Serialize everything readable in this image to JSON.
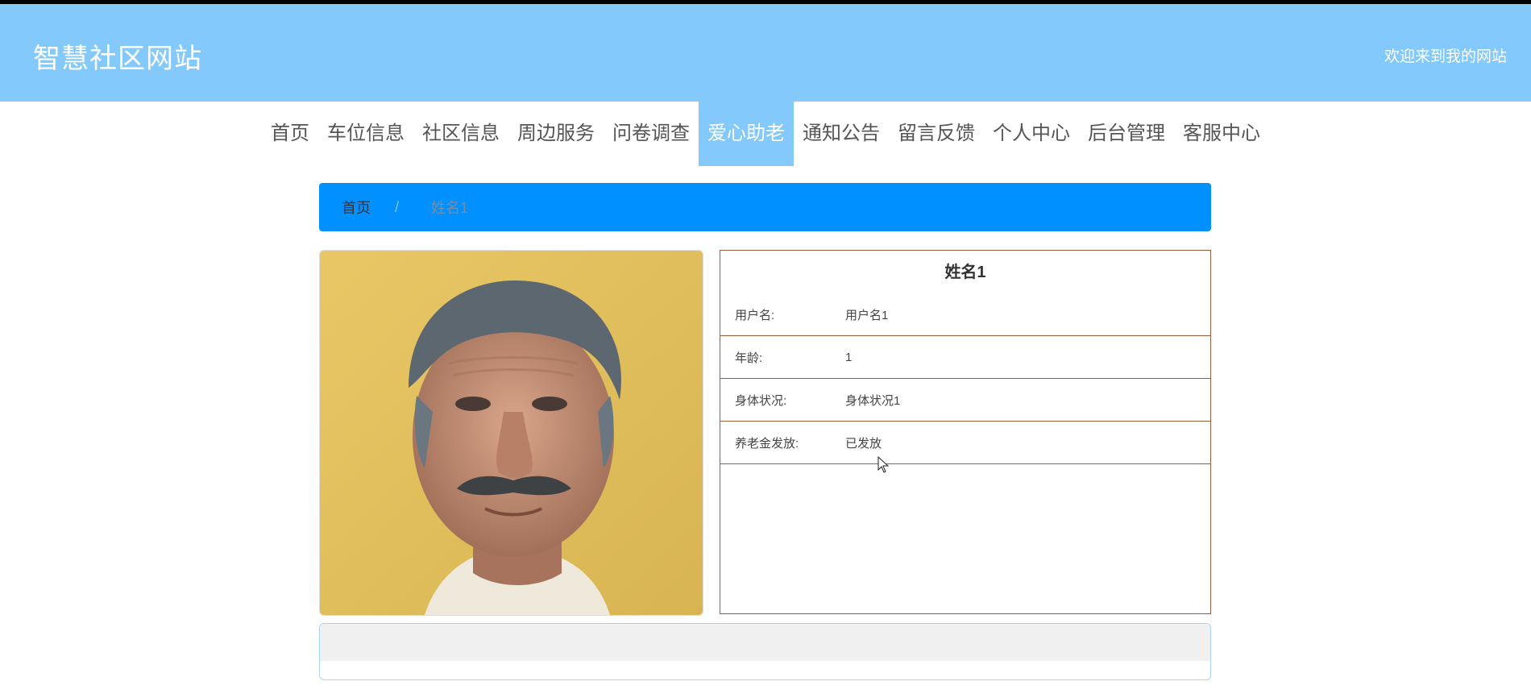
{
  "header": {
    "site_title": "智慧社区网站",
    "welcome": "欢迎来到我的网站",
    "bg_color": "#84c9fb"
  },
  "nav": {
    "items": [
      "首页",
      "车位信息",
      "社区信息",
      "周边服务",
      "问卷调查",
      "爱心助老",
      "通知公告",
      "留言反馈",
      "个人中心",
      "后台管理",
      "客服中心"
    ],
    "active": "爱心助老"
  },
  "breadcrumb": {
    "home": "首页",
    "separator": "/",
    "current": "姓名1",
    "bg_color": "#0090ff"
  },
  "photo": {
    "description_icon": "elderly-man-portrait"
  },
  "detail": {
    "name": "姓名1",
    "fields": [
      {
        "label": "用户名:",
        "value": "用户名1"
      },
      {
        "label": "年龄:",
        "value": "1"
      },
      {
        "label": "身体状况:",
        "value": "身体状况1"
      },
      {
        "label": "养老金发放:",
        "value": "已发放"
      }
    ]
  }
}
